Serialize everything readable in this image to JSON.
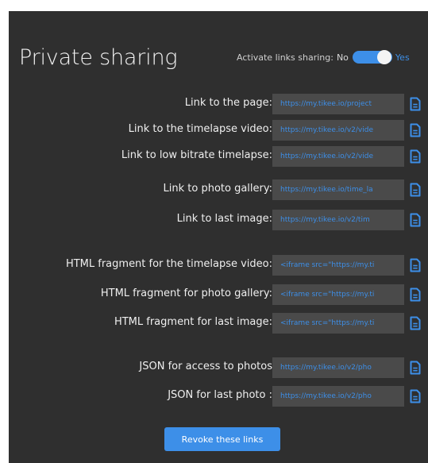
{
  "title": "Private sharing",
  "sharing_toggle": {
    "label": "Activate links sharing:",
    "off_label": "No",
    "on_label": "Yes",
    "state": "on"
  },
  "rows": [
    {
      "label": "Link to the page:",
      "value": "https://my.tikee.io/project"
    },
    {
      "label": "Link to the timelapse video:",
      "value": "https://my.tikee.io/v2/vide"
    },
    {
      "label": "Link to low bitrate timelapse:",
      "value": "https://my.tikee.io/v2/vide"
    },
    {
      "label": "Link to photo gallery:",
      "value": "https://my.tikee.io/time_la"
    },
    {
      "label": "Link to last image:",
      "value": "https://my.tikee.io/v2/tim"
    },
    {
      "label": "HTML fragment for the timelapse video:",
      "value": "<iframe src=\"https://my.ti"
    },
    {
      "label": "HTML fragment for photo gallery:",
      "value": "<iframe src=\"https://my.ti"
    },
    {
      "label": "HTML fragment for last image:",
      "value": "<iframe src=\"https://my.ti"
    },
    {
      "label": "JSON for access to photos",
      "value": "https://my.tikee.io/v2/pho"
    },
    {
      "label": "JSON for last photo :",
      "value": "https://my.tikee.io/v2/pho"
    }
  ],
  "copy_icon": "document-copy-icon",
  "revoke_label": "Revoke these links",
  "colors": {
    "accent": "#3d8fe8",
    "panel_bg": "#2f2f2f",
    "field_bg": "#4a4a4a"
  }
}
